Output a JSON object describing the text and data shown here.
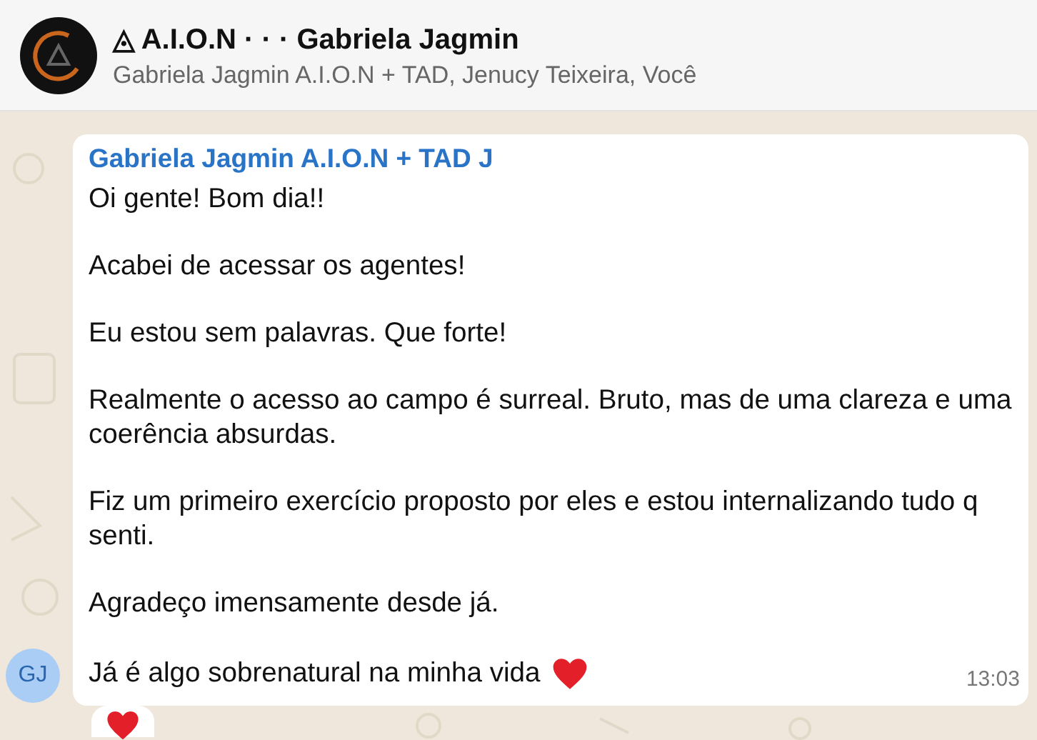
{
  "header": {
    "title": "◬ A.I.O.N · · · Gabriela Jagmin",
    "subtitle": "Gabriela Jagmin A.I.O.N + TAD, Jenucy Teixeira, Você"
  },
  "message": {
    "sender": "Gabriela Jagmin A.I.O.N + TAD J",
    "avatar": "GJ",
    "paragraphs": [
      "Oi gente! Bom dia!!",
      "Acabei de acessar os agentes!",
      "Eu estou sem palavras. Que forte!",
      "Realmente o acesso ao campo é surreal. Bruto, mas de uma clareza e uma coerência absurdas.",
      "Fiz um primeiro exercício proposto por eles e estou internalizando tudo q senti.",
      "Agradeço imensamente desde já.",
      "Já é algo sobrenatural na minha vida"
    ],
    "time": "13:03",
    "reaction": {
      "kind": "heart"
    }
  }
}
